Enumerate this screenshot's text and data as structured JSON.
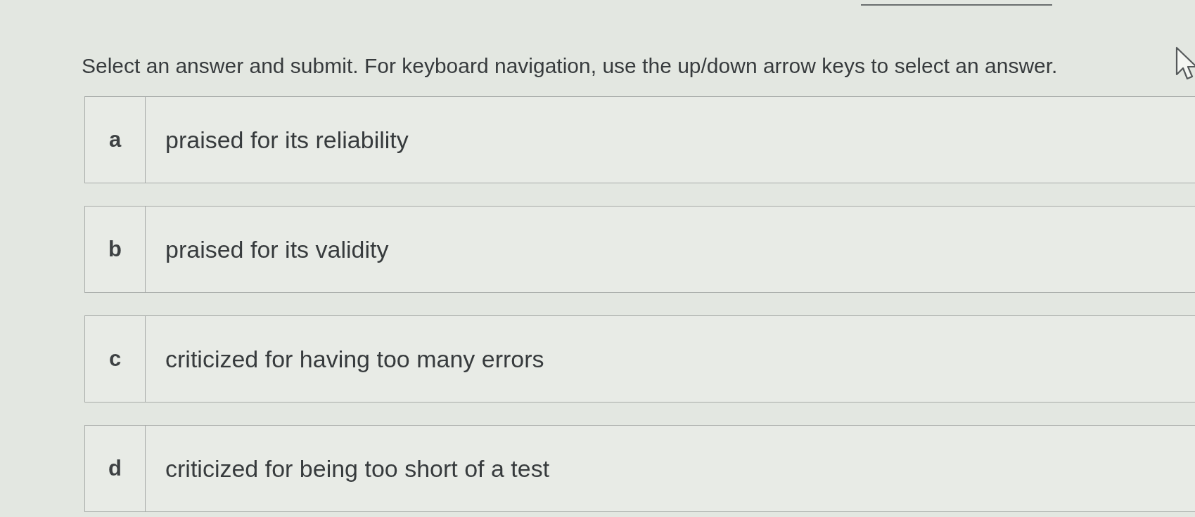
{
  "instructions": "Select an answer and submit. For keyboard navigation, use the up/down arrow keys to select an answer.",
  "options": [
    {
      "letter": "a",
      "text": "praised for its reliability",
      "selected": false
    },
    {
      "letter": "b",
      "text": "praised for its validity",
      "selected": false
    },
    {
      "letter": "c",
      "text": "criticized for having too many errors",
      "selected": false
    },
    {
      "letter": "d",
      "text": "criticized for being too short of a test",
      "selected": false
    }
  ]
}
